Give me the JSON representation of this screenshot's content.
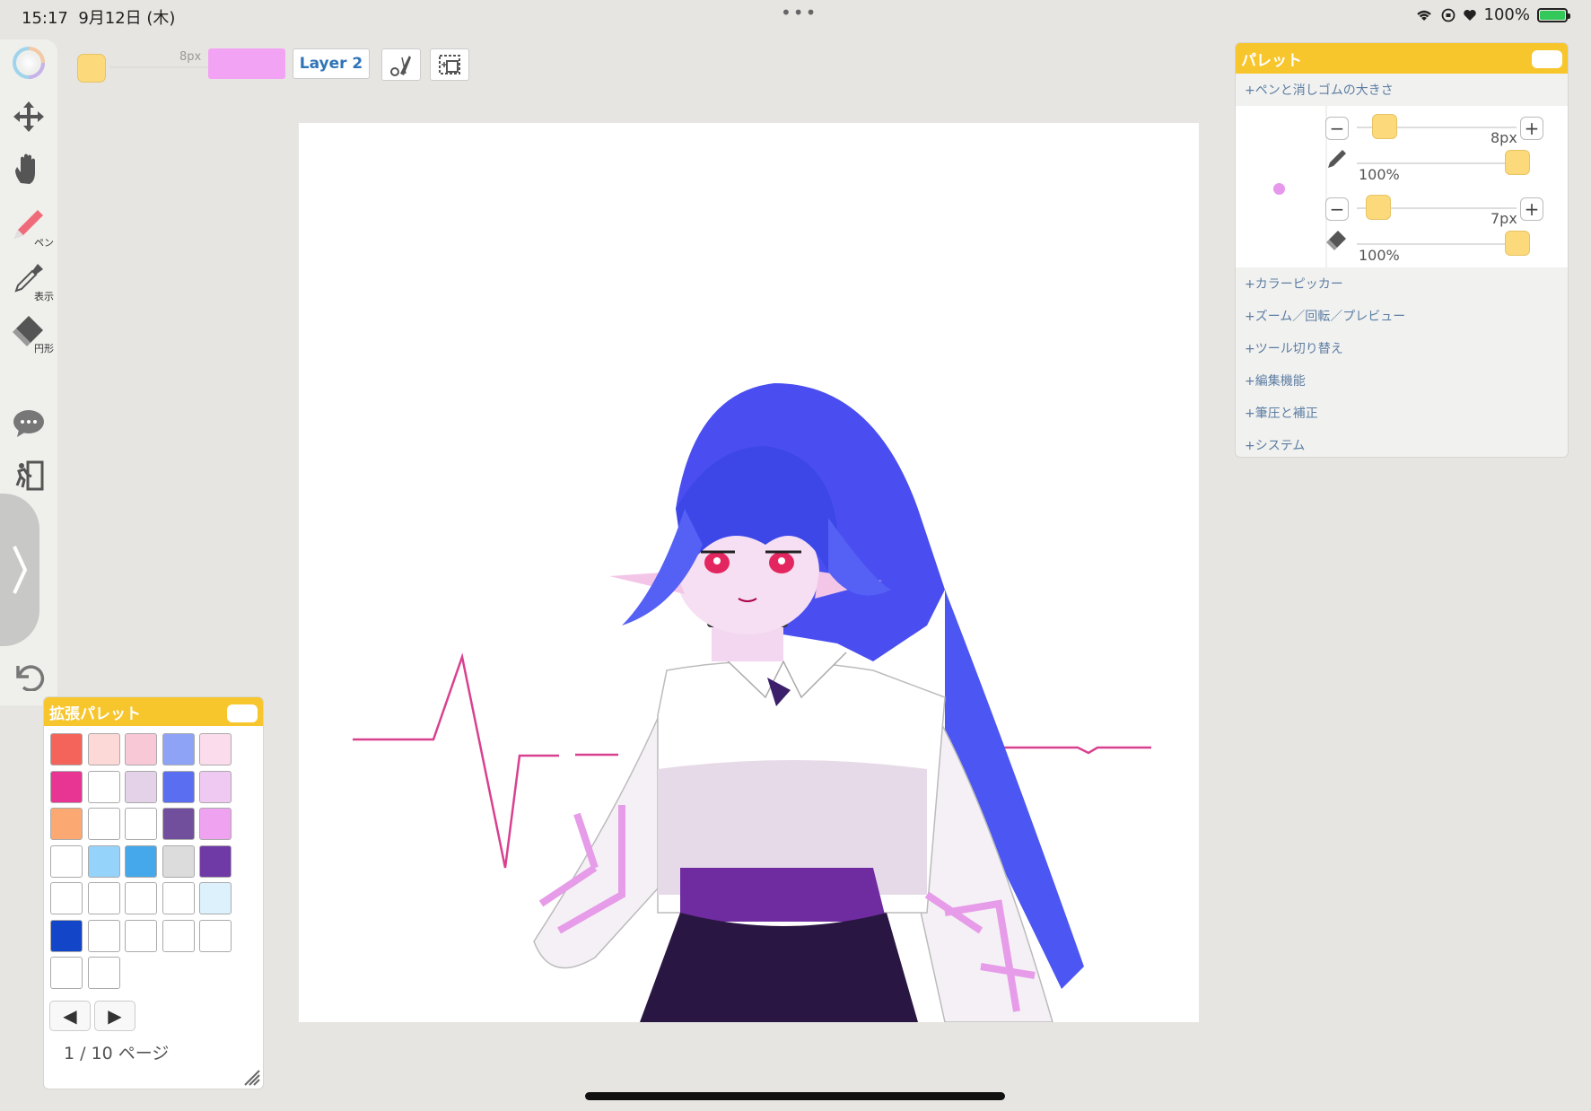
{
  "status": {
    "time": "15:17",
    "date": "9月12日 (木)",
    "battery": "100%",
    "menu_dots": "•••"
  },
  "toolbar": {
    "tools": [
      {
        "name": "color-wheel-icon"
      },
      {
        "name": "move-icon"
      },
      {
        "name": "hand-icon"
      },
      {
        "name": "pen-icon",
        "label": "ペン"
      },
      {
        "name": "eyedropper-icon",
        "label": "表示"
      },
      {
        "name": "eraser-icon",
        "label": "円形"
      },
      {
        "name": "chat-icon"
      },
      {
        "name": "exit-icon"
      },
      {
        "name": "undo-icon"
      }
    ],
    "colors": {
      "pen": "#ef6b7a",
      "icon": "#555555"
    }
  },
  "topbar": {
    "size_label": "8px",
    "primary_color": "#fcd97a",
    "secondary_color": "#f3a3f3",
    "layer_label": "Layer 2"
  },
  "palette": {
    "title": "パレット",
    "sections": {
      "pen_eraser": "+ペンと消しゴムの大きさ",
      "picker": "+カラーピッカー",
      "zoom": "+ズーム／回転／プレビュー",
      "tool_switch": "+ツール切り替え",
      "edit": "+編集機能",
      "pressure": "+筆圧と補正",
      "system": "+システム"
    },
    "pen": {
      "size": "8px",
      "opacity": "100%"
    },
    "eraser": {
      "size": "7px",
      "opacity": "100%"
    }
  },
  "ext_palette": {
    "title": "拡張パレット",
    "page_info": "1 / 10 ページ",
    "cells": [
      [
        "#f4645a",
        "#fcd8d6",
        "#f9c8d6",
        "#8ea3f6",
        "#fbdcec"
      ],
      [
        "#e83593",
        "#ffffff",
        "#e3d2e8",
        "#5a6ef2",
        "#efc9f2"
      ],
      [
        "#fba873",
        "#ffffff",
        "#ffffff",
        "#714f9c",
        "#eea2f0"
      ],
      [
        "#ffffff",
        "#96d3fa",
        "#44a8ea",
        "#dcdcdc",
        "#6f3aa6"
      ],
      [
        "#ffffff",
        "#ffffff",
        "#ffffff",
        "#ffffff",
        "#ddf1fd"
      ],
      [
        "#1245c8",
        "#ffffff",
        "#ffffff",
        "#ffffff",
        "#ffffff"
      ],
      [
        "#ffffff",
        "#ffffff"
      ]
    ]
  },
  "accent": "#f7c52c"
}
